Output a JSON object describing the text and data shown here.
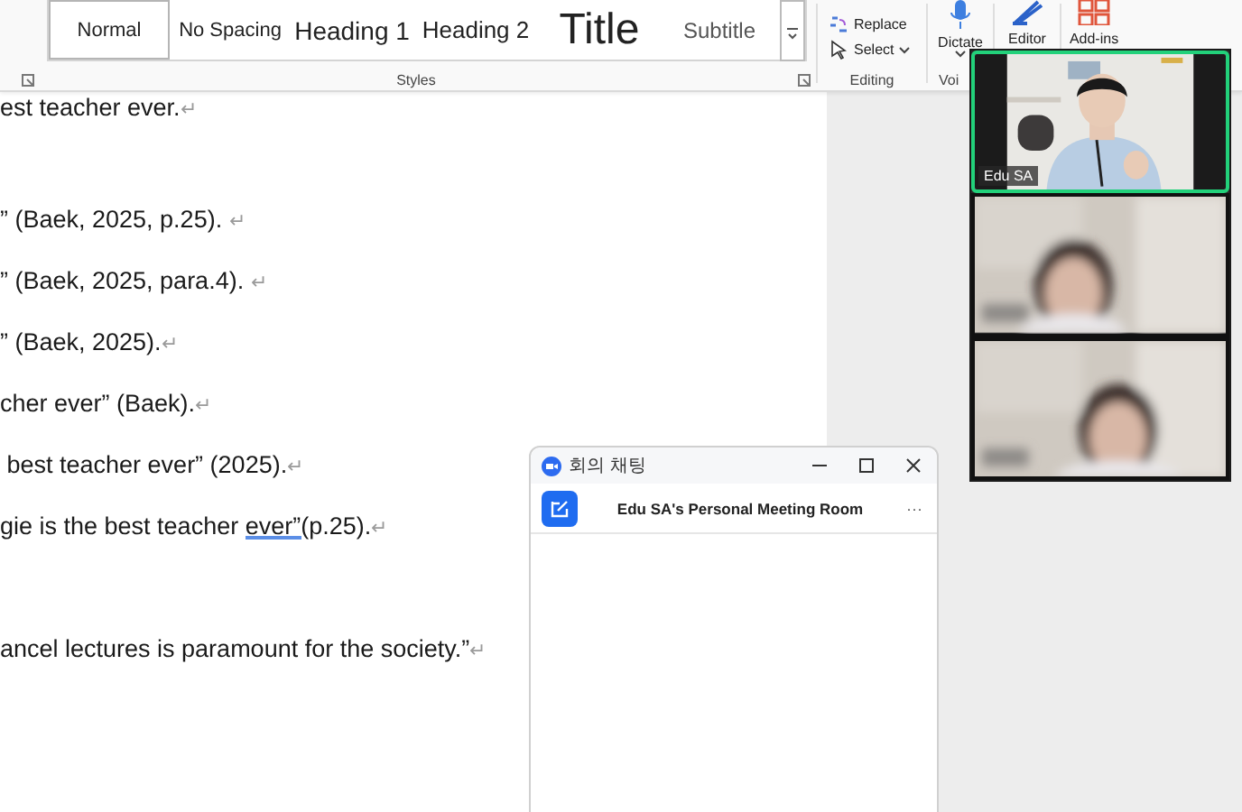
{
  "ribbon": {
    "styles": [
      {
        "label": "Normal",
        "kind": "normal",
        "selected": true
      },
      {
        "label": "No Spacing",
        "kind": "nospacing",
        "selected": false
      },
      {
        "label": "Heading 1",
        "kind": "heading1",
        "selected": false
      },
      {
        "label": "Heading 2",
        "kind": "heading2",
        "selected": false
      },
      {
        "label": "Title",
        "kind": "title",
        "selected": false
      },
      {
        "label": "Subtitle",
        "kind": "subtitle",
        "selected": false
      }
    ],
    "styles_label": "Styles",
    "editing": {
      "items": [
        {
          "label": "Replace",
          "kind": "replace"
        },
        {
          "label": "Select",
          "kind": "select"
        }
      ],
      "label": "Editing"
    },
    "voice": {
      "button": "Dictate",
      "label": "Voi"
    },
    "editor": {
      "button": "Editor"
    },
    "addins": {
      "button": "Add-ins"
    }
  },
  "document": {
    "lines": [
      {
        "kind": "text",
        "segments": [
          {
            "text": "est teacher ever.",
            "flagged": false
          }
        ],
        "mark": "↵"
      },
      {
        "kind": "blank"
      },
      {
        "kind": "text",
        "segments": [
          {
            "text": "” (Baek, 2025, p.25). ",
            "flagged": false
          }
        ],
        "mark": "↵"
      },
      {
        "kind": "text",
        "segments": [
          {
            "text": "” (Baek, 2025, para.4). ",
            "flagged": false
          }
        ],
        "mark": "↵"
      },
      {
        "kind": "text",
        "segments": [
          {
            "text": "” (Baek, 2025).",
            "flagged": false
          }
        ],
        "mark": "↵"
      },
      {
        "kind": "text",
        "segments": [
          {
            "text": "cher ever” (Baek).",
            "flagged": false
          }
        ],
        "mark": "↵"
      },
      {
        "kind": "text",
        "segments": [
          {
            "text": " best teacher ever” (2025).",
            "flagged": false
          }
        ],
        "mark": "↵"
      },
      {
        "kind": "text",
        "segments": [
          {
            "text": "gie is the best teacher ",
            "flagged": false
          },
          {
            "text": "ever”",
            "flagged": true
          },
          {
            "text": "(p.25).",
            "flagged": false
          }
        ],
        "mark": "↵"
      },
      {
        "kind": "blank"
      },
      {
        "kind": "text",
        "segments": [
          {
            "text": "ancel lectures is paramount for the society.”",
            "flagged": false
          }
        ],
        "mark": "↵"
      }
    ]
  },
  "chat_window": {
    "title": "회의 채팅",
    "room": "Edu SA's Personal Meeting Room",
    "more": "···"
  },
  "video_panel": {
    "tiles": [
      {
        "name": "Edu SA",
        "speaking": true,
        "kind": "presenter"
      },
      {
        "speaking": false,
        "kind": "blurred"
      },
      {
        "speaking": false,
        "kind": "blurred"
      }
    ]
  }
}
